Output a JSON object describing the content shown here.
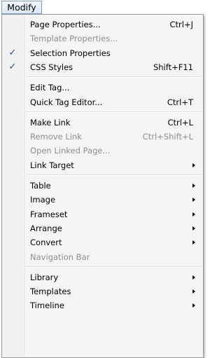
{
  "menubar": {
    "label": "Modify"
  },
  "menu": {
    "groups": [
      [
        {
          "label": "Page Properties...",
          "shortcut": "Ctrl+J",
          "enabled": true,
          "checked": false,
          "submenu": false
        },
        {
          "label": "Template Properties...",
          "shortcut": "",
          "enabled": false,
          "checked": false,
          "submenu": false
        },
        {
          "label": "Selection Properties",
          "shortcut": "",
          "enabled": true,
          "checked": true,
          "submenu": false
        },
        {
          "label": "CSS Styles",
          "shortcut": "Shift+F11",
          "enabled": true,
          "checked": true,
          "submenu": false
        }
      ],
      [
        {
          "label": "Edit Tag...",
          "shortcut": "",
          "enabled": true,
          "checked": false,
          "submenu": false
        },
        {
          "label": "Quick Tag Editor...",
          "shortcut": "Ctrl+T",
          "enabled": true,
          "checked": false,
          "submenu": false
        }
      ],
      [
        {
          "label": "Make Link",
          "shortcut": "Ctrl+L",
          "enabled": true,
          "checked": false,
          "submenu": false
        },
        {
          "label": "Remove Link",
          "shortcut": "Ctrl+Shift+L",
          "enabled": false,
          "checked": false,
          "submenu": false
        },
        {
          "label": "Open Linked Page...",
          "shortcut": "",
          "enabled": false,
          "checked": false,
          "submenu": false
        },
        {
          "label": "Link Target",
          "shortcut": "",
          "enabled": true,
          "checked": false,
          "submenu": true
        }
      ],
      [
        {
          "label": "Table",
          "shortcut": "",
          "enabled": true,
          "checked": false,
          "submenu": true
        },
        {
          "label": "Image",
          "shortcut": "",
          "enabled": true,
          "checked": false,
          "submenu": true
        },
        {
          "label": "Frameset",
          "shortcut": "",
          "enabled": true,
          "checked": false,
          "submenu": true
        },
        {
          "label": "Arrange",
          "shortcut": "",
          "enabled": true,
          "checked": false,
          "submenu": true
        },
        {
          "label": "Convert",
          "shortcut": "",
          "enabled": true,
          "checked": false,
          "submenu": true
        },
        {
          "label": "Navigation Bar",
          "shortcut": "",
          "enabled": false,
          "checked": false,
          "submenu": false
        }
      ],
      [
        {
          "label": "Library",
          "shortcut": "",
          "enabled": true,
          "checked": false,
          "submenu": true
        },
        {
          "label": "Templates",
          "shortcut": "",
          "enabled": true,
          "checked": false,
          "submenu": true
        },
        {
          "label": "Timeline",
          "shortcut": "",
          "enabled": true,
          "checked": false,
          "submenu": true
        }
      ]
    ],
    "check_glyph": "✓",
    "colors": {
      "text": "#000000",
      "disabled_text": "#8d8d8d",
      "check": "#1e4e9e",
      "menu_background": "#f5f5f5",
      "menubar_highlight_border": "#7a9cc6"
    }
  }
}
